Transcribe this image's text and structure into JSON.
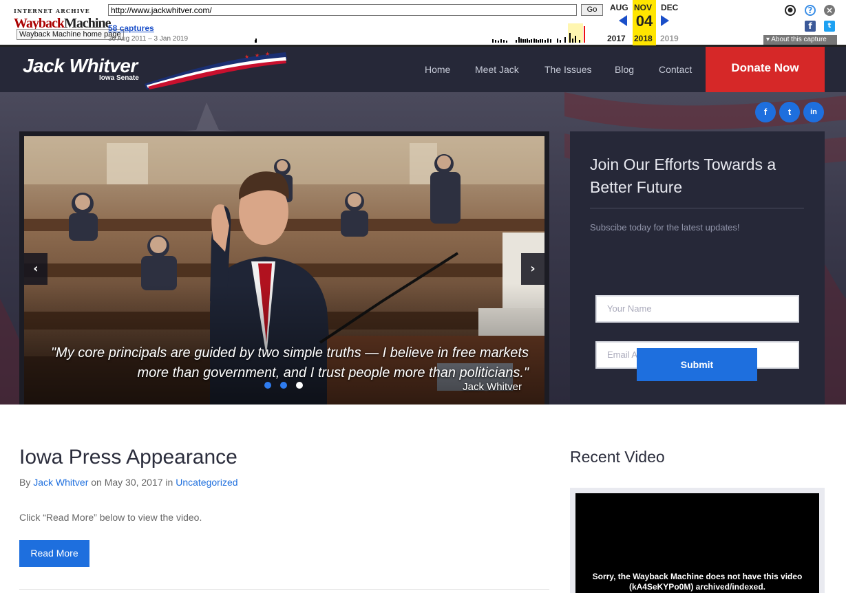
{
  "wayback": {
    "logo_top": "INTERNET ARCHIVE",
    "logo_main_red": "Wayback",
    "logo_main_black": "Machine",
    "tooltip": "Wayback Machine home page",
    "url": "http://www.jackwhitver.com/",
    "go_label": "Go",
    "captures_link": "58 captures",
    "capture_range": "30 Aug 2011 – 3 Jan 2019",
    "month_prev": "AUG",
    "month_cur": "NOV",
    "month_next": "DEC",
    "day": "04",
    "year_prev": "2017",
    "year_cur": "2018",
    "year_next": "2019",
    "about_label": "About this capture",
    "icons": [
      "user-icon",
      "help-icon",
      "close-icon",
      "facebook-icon",
      "twitter-icon"
    ]
  },
  "site": {
    "logo_name": "Jack Whitver",
    "logo_subtitle": "Iowa Senate",
    "nav": [
      "Home",
      "Meet Jack",
      "The Issues",
      "Blog",
      "Contact"
    ],
    "donate_label": "Donate Now",
    "social": [
      "f",
      "t",
      "in"
    ]
  },
  "slider": {
    "quote": "\"My core principals are guided by two simple truths — I believe in free markets more than government, and I trust people more than politicians.\"",
    "quote_by": "Jack Whitver",
    "prev_icon": "chevron-left-icon",
    "next_icon": "chevron-right-icon",
    "slides": 3,
    "active_slide": 3
  },
  "signup": {
    "title": "Join Our Efforts Towards a Better Future",
    "subtitle": "Subscibe today for the latest updates!",
    "name_placeholder": "Your Name",
    "email_placeholder": "Email Address",
    "submit_label": "Submit"
  },
  "post": {
    "title": "Iowa Press Appearance",
    "meta_by": "By ",
    "author": "Jack Whitver",
    "meta_on": " on May 30, 2017 in ",
    "category": "Uncategorized",
    "body": "Click “Read More” below to view the video.",
    "read_more_label": "Read More"
  },
  "recent_video": {
    "title": "Recent Video",
    "message": "Sorry, the Wayback Machine does not have this video (kA4SeKYPo0M) archived/indexed."
  },
  "colors": {
    "header_bg": "#262838",
    "donate_red": "#d62828",
    "accent_blue": "#1e6fde",
    "wayback_yellow": "#ffe500"
  }
}
